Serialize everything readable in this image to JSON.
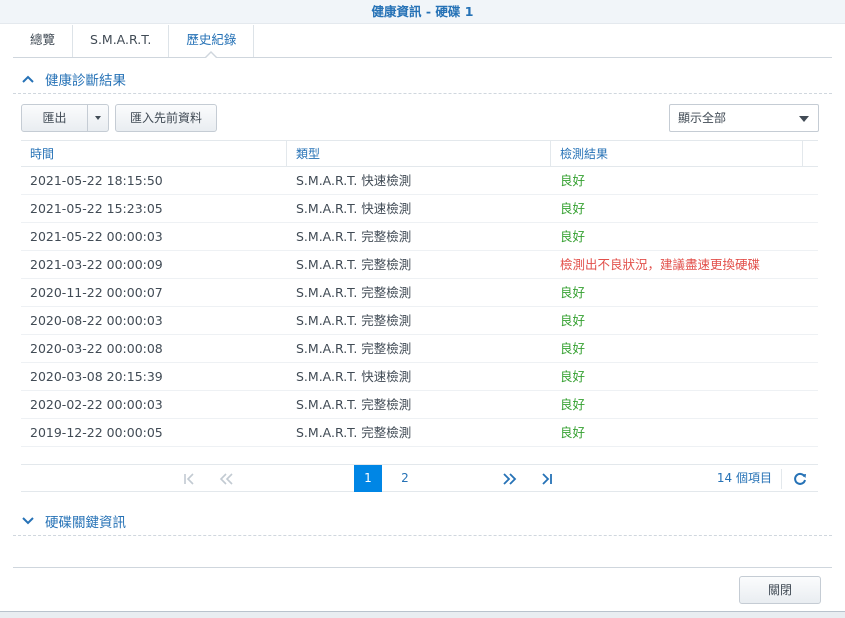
{
  "window": {
    "title": "健康資訊 - 硬碟 1"
  },
  "tabs": [
    {
      "label": "總覽",
      "active": false
    },
    {
      "label": "S.M.A.R.T.",
      "active": false
    },
    {
      "label": "歷史紀錄",
      "active": true
    }
  ],
  "section_health": {
    "title": "健康診斷結果",
    "expanded": true
  },
  "toolbar": {
    "export_label": "匯出",
    "import_label": "匯入先前資料",
    "filter_value": "顯示全部"
  },
  "grid": {
    "columns": [
      "時間",
      "類型",
      "檢測結果"
    ],
    "rows": [
      {
        "time": "2021-05-22 18:15:50",
        "type": "S.M.A.R.T. 快速檢測",
        "result": "良好",
        "status": "good"
      },
      {
        "time": "2021-05-22 15:23:05",
        "type": "S.M.A.R.T. 快速檢測",
        "result": "良好",
        "status": "good"
      },
      {
        "time": "2021-05-22 00:00:03",
        "type": "S.M.A.R.T. 完整檢測",
        "result": "良好",
        "status": "good"
      },
      {
        "time": "2021-03-22 00:00:09",
        "type": "S.M.A.R.T. 完整檢測",
        "result": "檢測出不良狀況，建議盡速更換硬碟",
        "status": "bad"
      },
      {
        "time": "2020-11-22 00:00:07",
        "type": "S.M.A.R.T. 完整檢測",
        "result": "良好",
        "status": "good"
      },
      {
        "time": "2020-08-22 00:00:03",
        "type": "S.M.A.R.T. 完整檢測",
        "result": "良好",
        "status": "good"
      },
      {
        "time": "2020-03-22 00:00:08",
        "type": "S.M.A.R.T. 完整檢測",
        "result": "良好",
        "status": "good"
      },
      {
        "time": "2020-03-08 20:15:39",
        "type": "S.M.A.R.T. 快速檢測",
        "result": "良好",
        "status": "good"
      },
      {
        "time": "2020-02-22 00:00:03",
        "type": "S.M.A.R.T. 完整檢測",
        "result": "良好",
        "status": "good"
      },
      {
        "time": "2019-12-22 00:00:05",
        "type": "S.M.A.R.T. 完整檢測",
        "result": "良好",
        "status": "good"
      }
    ]
  },
  "pager": {
    "pages": [
      "1",
      "2"
    ],
    "current_page": 1,
    "total_label": "14 個項目"
  },
  "section_disk_info": {
    "title": "硬碟關鍵資訊",
    "expanded": false
  },
  "footer": {
    "close_label": "關閉"
  },
  "colors": {
    "accent": "#2672b6",
    "good": "#36a132",
    "bad": "#e2504b",
    "current_page_bg": "#0086e5"
  }
}
